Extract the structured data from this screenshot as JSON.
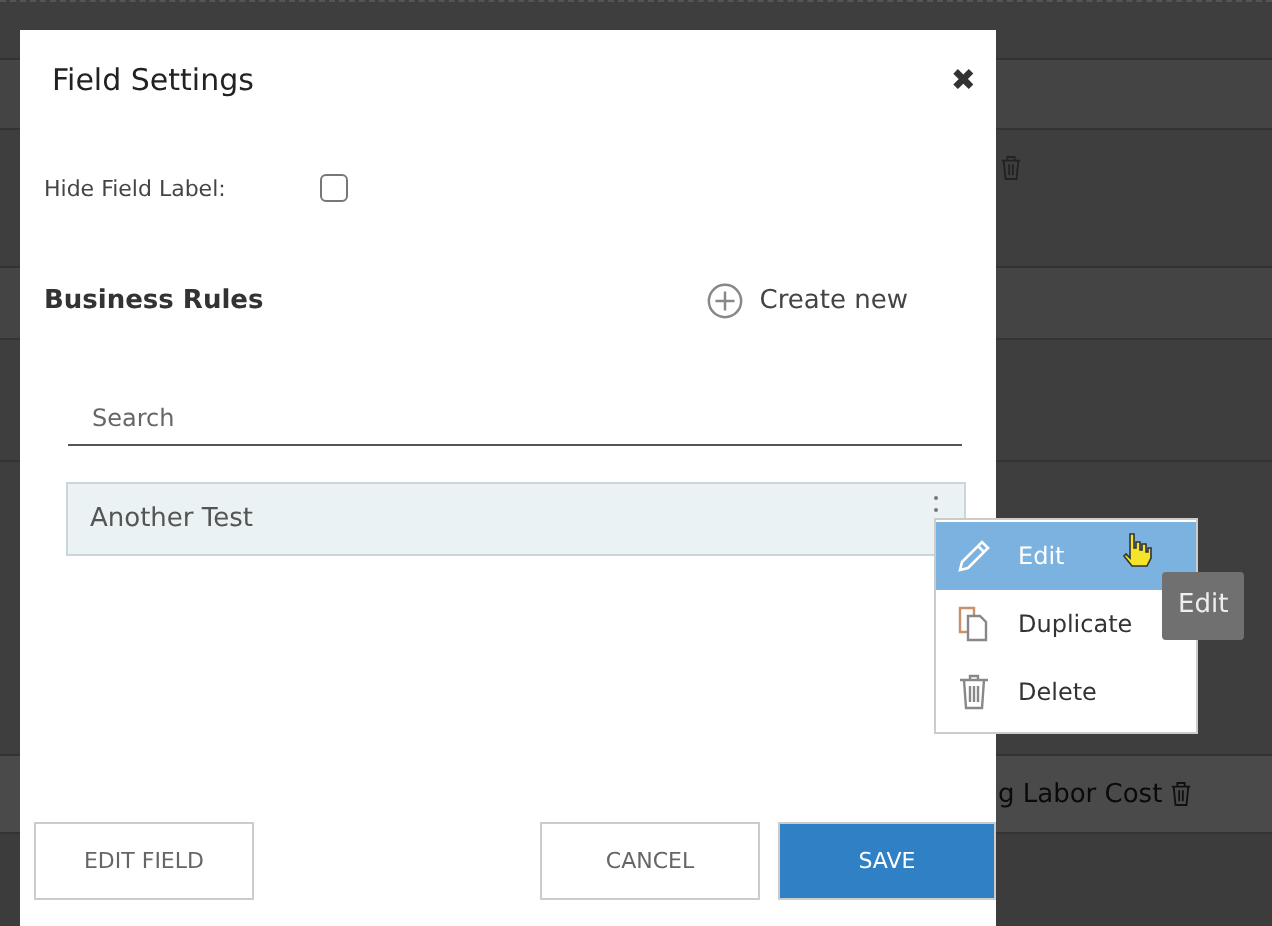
{
  "background": {
    "rows": [
      {
        "text": "g Labor Cost"
      }
    ]
  },
  "dialog": {
    "title": "Field Settings",
    "close": "✖",
    "hide_field_label": {
      "label": "Hide Field Label:",
      "checked": false
    },
    "business_rules": {
      "heading": "Business Rules",
      "create_new": "Create new"
    },
    "search": {
      "placeholder": "Search"
    },
    "rules": [
      {
        "name": "Another Test"
      }
    ],
    "context_menu": [
      {
        "kind": "edit",
        "label": "Edit",
        "selected": true
      },
      {
        "kind": "duplicate",
        "label": "Duplicate",
        "selected": false
      },
      {
        "kind": "delete",
        "label": "Delete",
        "selected": false
      }
    ],
    "tooltip": "Edit",
    "buttons": [
      {
        "kind": "secondary",
        "label": "EDIT FIELD"
      },
      {
        "kind": "secondary",
        "label": "CANCEL"
      },
      {
        "kind": "primary",
        "label": "SAVE"
      }
    ]
  }
}
